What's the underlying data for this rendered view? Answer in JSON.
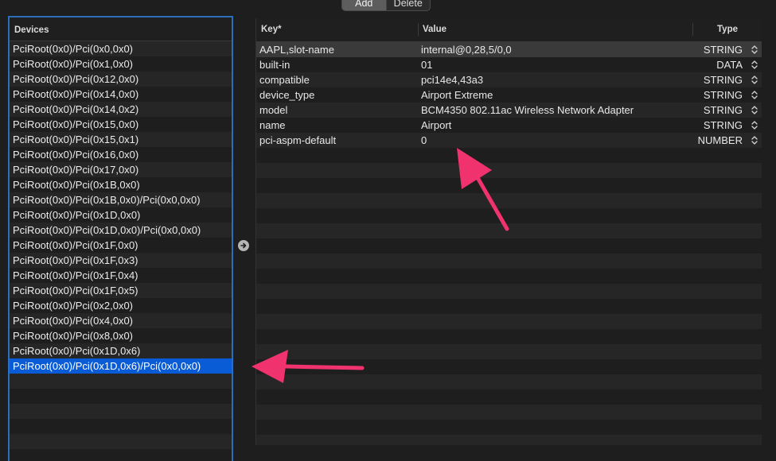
{
  "toolbar": {
    "add_label": "Add",
    "delete_label": "Delete"
  },
  "devices": {
    "header": "Devices",
    "items": [
      "PciRoot(0x0)/Pci(0x0,0x0)",
      "PciRoot(0x0)/Pci(0x1,0x0)",
      "PciRoot(0x0)/Pci(0x12,0x0)",
      "PciRoot(0x0)/Pci(0x14,0x0)",
      "PciRoot(0x0)/Pci(0x14,0x2)",
      "PciRoot(0x0)/Pci(0x15,0x0)",
      "PciRoot(0x0)/Pci(0x15,0x1)",
      "PciRoot(0x0)/Pci(0x16,0x0)",
      "PciRoot(0x0)/Pci(0x17,0x0)",
      "PciRoot(0x0)/Pci(0x1B,0x0)",
      "PciRoot(0x0)/Pci(0x1B,0x0)/Pci(0x0,0x0)",
      "PciRoot(0x0)/Pci(0x1D,0x0)",
      "PciRoot(0x0)/Pci(0x1D,0x0)/Pci(0x0,0x0)",
      "PciRoot(0x0)/Pci(0x1F,0x0)",
      "PciRoot(0x0)/Pci(0x1F,0x3)",
      "PciRoot(0x0)/Pci(0x1F,0x4)",
      "PciRoot(0x0)/Pci(0x1F,0x5)",
      "PciRoot(0x0)/Pci(0x2,0x0)",
      "PciRoot(0x0)/Pci(0x4,0x0)",
      "PciRoot(0x0)/Pci(0x8,0x0)",
      "PciRoot(0x0)/Pci(0x1D,0x6)",
      "PciRoot(0x0)/Pci(0x1D,0x6)/Pci(0x0,0x0)"
    ],
    "selected_index": 21
  },
  "properties": {
    "columns": {
      "key": "Key*",
      "value": "Value",
      "type": "Type"
    },
    "rows": [
      {
        "key": "AAPL,slot-name",
        "value": "internal@0,28,5/0,0",
        "type": "STRING"
      },
      {
        "key": "built-in",
        "value": "01",
        "type": "DATA"
      },
      {
        "key": "compatible",
        "value": "pci14e4,43a3",
        "type": "STRING"
      },
      {
        "key": "device_type",
        "value": "Airport Extreme",
        "type": "STRING"
      },
      {
        "key": "model",
        "value": "BCM4350 802.11ac Wireless Network Adapter",
        "type": "STRING"
      },
      {
        "key": "name",
        "value": "Airport",
        "type": "STRING"
      },
      {
        "key": "pci-aspm-default",
        "value": "0",
        "type": "NUMBER"
      }
    ]
  },
  "colors": {
    "selection": "#0a5cd6",
    "focus_border": "#2b6fbc",
    "annotation_arrow": "#f0326e"
  },
  "icons": {
    "move_right": "arrow-right-circle-icon",
    "stepper": "up-down-chevron-icon"
  }
}
